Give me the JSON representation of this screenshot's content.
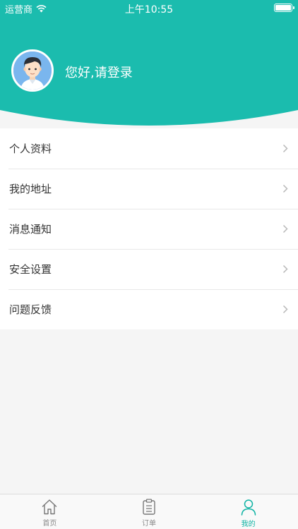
{
  "status_bar": {
    "carrier": "运营商",
    "time": "上午10:55"
  },
  "header": {
    "greeting": "您好,请登录",
    "color": "#1bbcae"
  },
  "menu": {
    "items": [
      {
        "label": "个人资料"
      },
      {
        "label": "我的地址"
      },
      {
        "label": "消息通知"
      },
      {
        "label": "安全设置"
      },
      {
        "label": "问题反馈"
      }
    ]
  },
  "tabbar": {
    "active_color": "#0fb3a4",
    "tabs": [
      {
        "label": "首页",
        "icon": "home-icon",
        "active": false
      },
      {
        "label": "订单",
        "icon": "clipboard-icon",
        "active": false
      },
      {
        "label": "我的",
        "icon": "user-icon",
        "active": true
      }
    ]
  }
}
